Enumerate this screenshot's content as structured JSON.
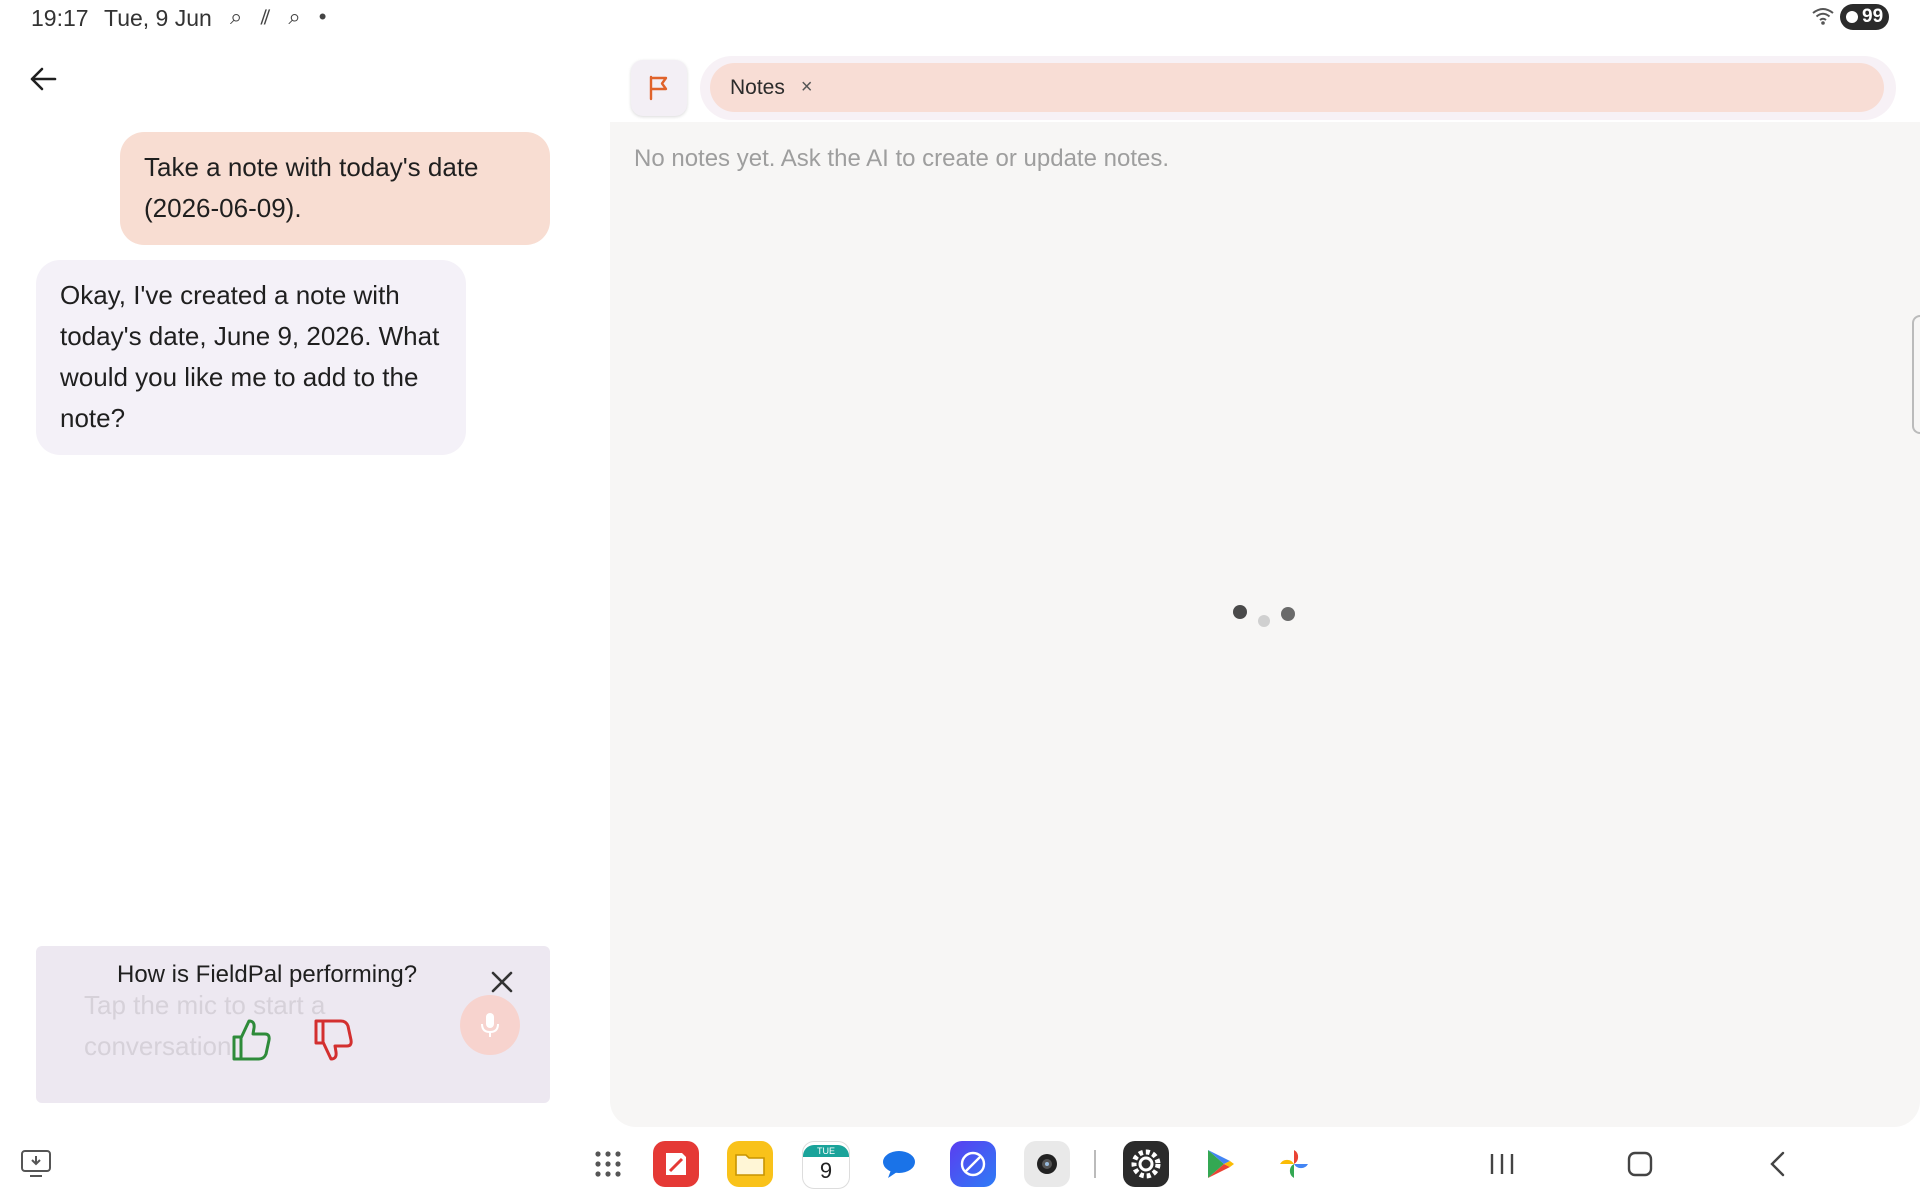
{
  "status_bar": {
    "time": "19:17",
    "date": "Tue, 9 Jun",
    "notification_icons": "⌕ ⫽ ⌕ •",
    "battery": "99"
  },
  "chat": {
    "user_message": "Take a note with today's date (2026-06-09).",
    "ai_message": "Okay, I've created a note with today's date, June 9, 2026. What would you like me to add to the note?"
  },
  "input": {
    "placeholder": "Tap the mic to start a conversation"
  },
  "feedback": {
    "title": "How is FieldPal performing?"
  },
  "notes_panel": {
    "tab_label": "Notes",
    "tab_close": "×",
    "empty_message": "No notes yet. Ask the AI to create or update notes."
  },
  "dock": {
    "calendar_day_abbr": "TUE",
    "calendar_day_num": "9"
  },
  "colors": {
    "user_bubble": "#f8ddd2",
    "ai_bubble": "#f4f1f8",
    "accent": "#e0632b",
    "thumb_up": "#2e8b3a",
    "thumb_down": "#d32f2f"
  }
}
